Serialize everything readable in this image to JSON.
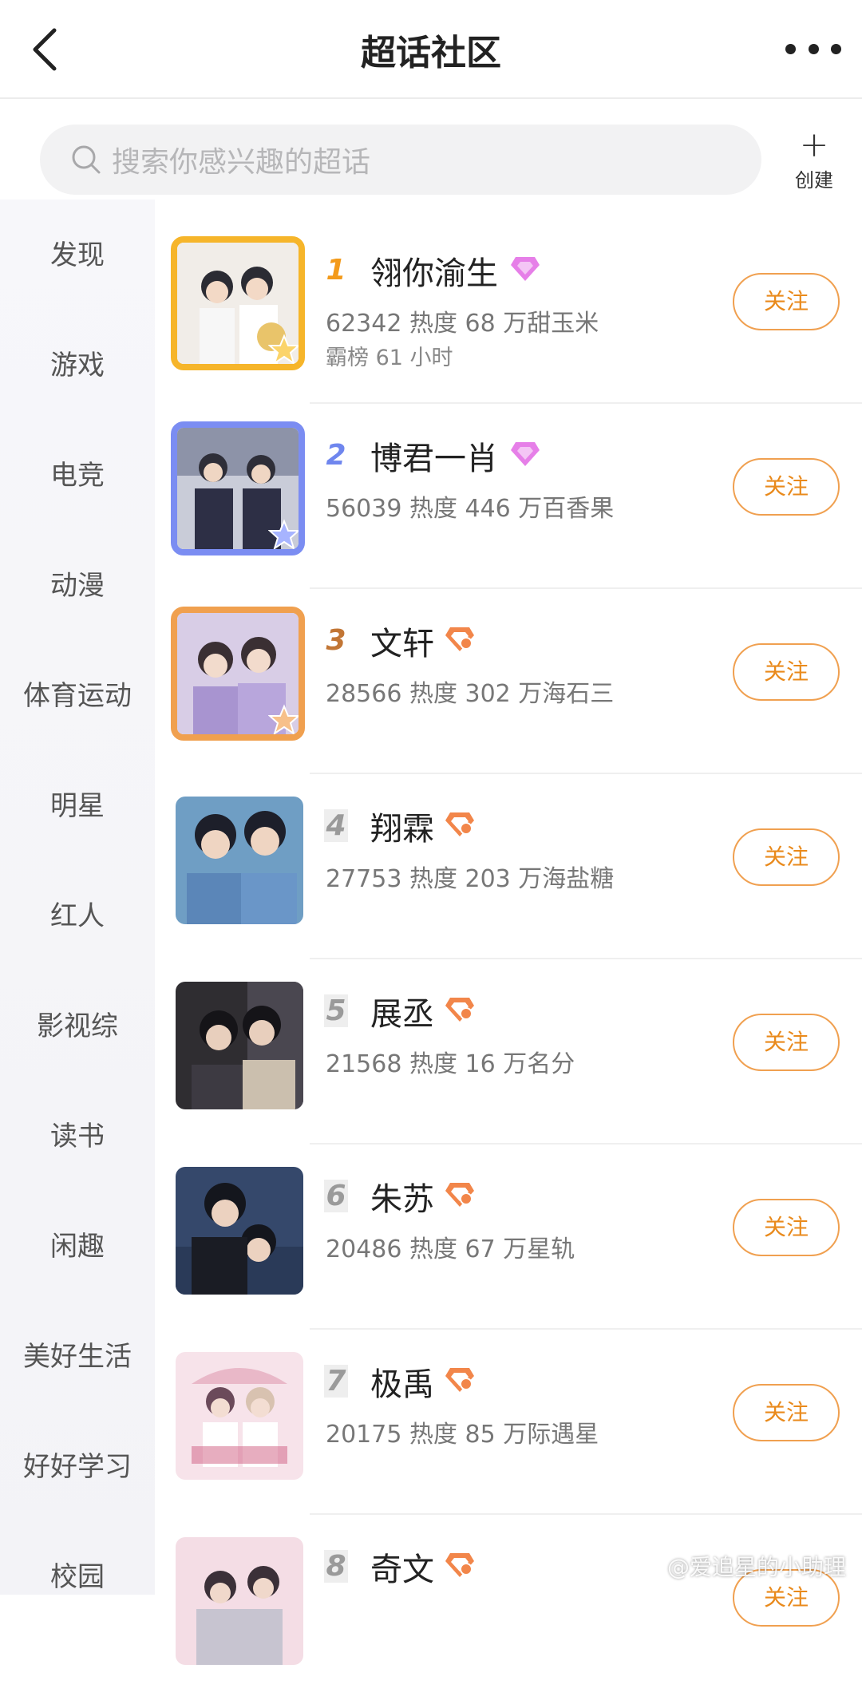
{
  "header": {
    "title": "超话社区"
  },
  "search": {
    "placeholder": "搜索你感兴趣的超话"
  },
  "create": {
    "label": "创建"
  },
  "sidebar": {
    "items": [
      {
        "label": "发现"
      },
      {
        "label": "游戏"
      },
      {
        "label": "电竞"
      },
      {
        "label": "动漫"
      },
      {
        "label": "体育运动"
      },
      {
        "label": "明星"
      },
      {
        "label": "红人"
      },
      {
        "label": "影视综"
      },
      {
        "label": "读书"
      },
      {
        "label": "闲趣"
      },
      {
        "label": "美好生活"
      },
      {
        "label": "好好学习"
      },
      {
        "label": "校园"
      }
    ]
  },
  "list": {
    "follow_label": "关注",
    "items": [
      {
        "rank": "1",
        "name": "翎你渝生",
        "stats": "62342 热度 68 万甜玉米",
        "sub": "霸榜 61 小时"
      },
      {
        "rank": "2",
        "name": "博君一肖",
        "stats": "56039 热度 446 万百香果",
        "sub": ""
      },
      {
        "rank": "3",
        "name": "文轩",
        "stats": "28566 热度 302 万海石三",
        "sub": ""
      },
      {
        "rank": "4",
        "name": "翔霖",
        "stats": "27753 热度 203 万海盐糖",
        "sub": ""
      },
      {
        "rank": "5",
        "name": "展丞",
        "stats": "21568 热度 16 万名分",
        "sub": ""
      },
      {
        "rank": "6",
        "name": "朱苏",
        "stats": "20486 热度 67 万星轨",
        "sub": ""
      },
      {
        "rank": "7",
        "name": "极禹",
        "stats": "20175 热度 85 万际遇星",
        "sub": ""
      },
      {
        "rank": "8",
        "name": "奇文",
        "stats": "",
        "sub": ""
      }
    ]
  },
  "watermark": "@爱追星的小助理",
  "colors": {
    "accent": "#e98a1c",
    "gold": "#f6b52a",
    "blue": "#7b8df2",
    "bronze": "#f0a04f"
  }
}
